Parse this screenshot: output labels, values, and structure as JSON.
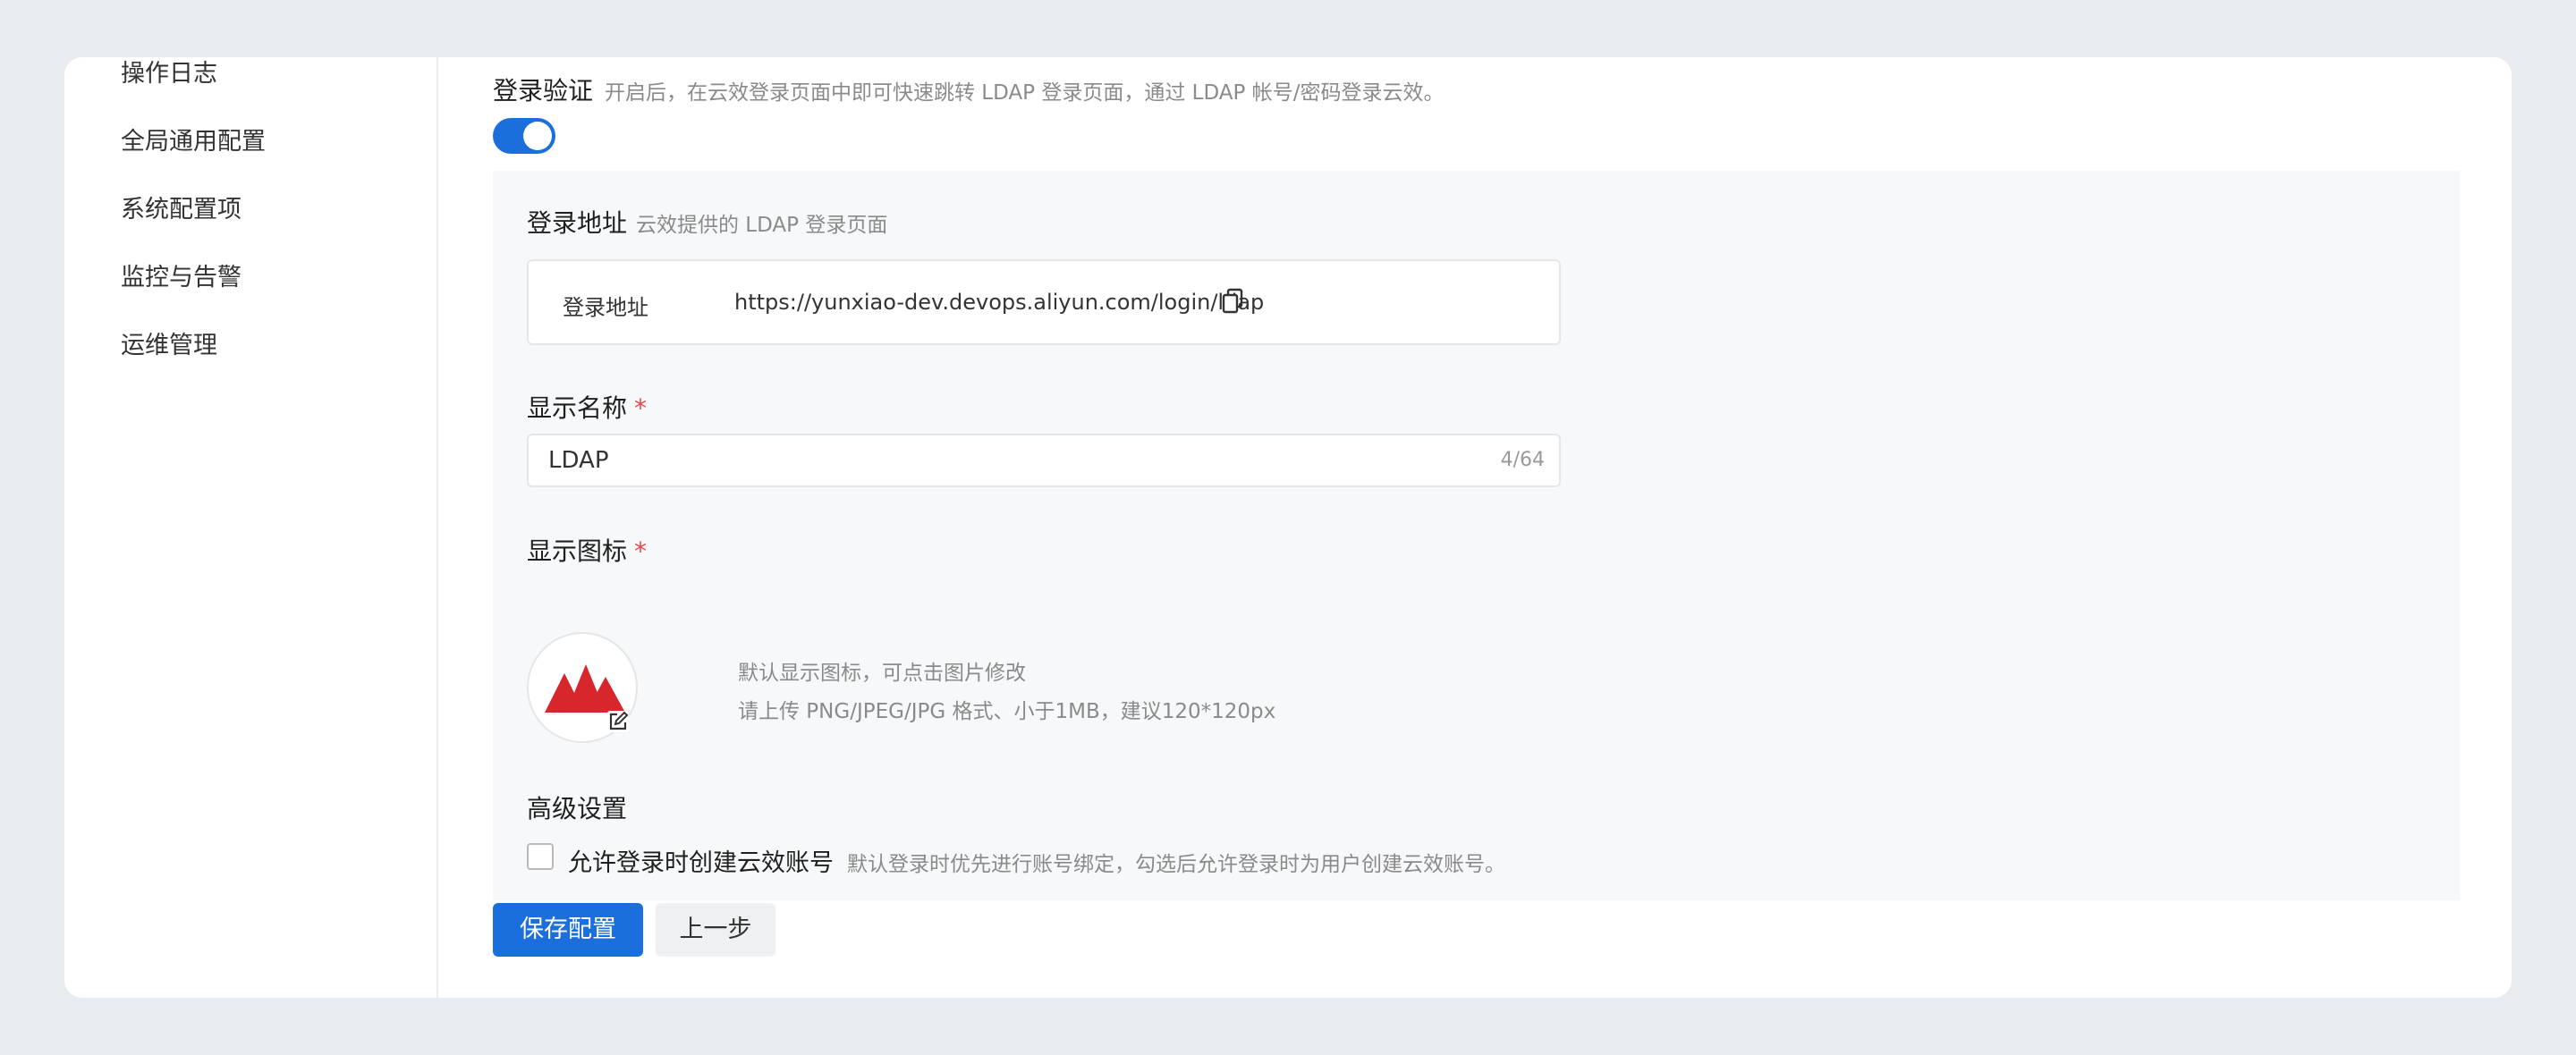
{
  "sidebar": {
    "items": [
      {
        "label": "操作日志"
      },
      {
        "label": "全局通用配置"
      },
      {
        "label": "系统配置项"
      },
      {
        "label": "监控与告警"
      },
      {
        "label": "运维管理"
      }
    ]
  },
  "login_verify": {
    "label": "登录验证",
    "hint": "开启后，在云效登录页面中即可快速跳转 LDAP 登录页面，通过 LDAP 帐号/密码登录云效。",
    "enabled": true
  },
  "login_url": {
    "label": "登录地址",
    "hint": "云效提供的 LDAP 登录页面",
    "key": "登录地址",
    "value": "https://yunxiao-dev.devops.aliyun.com/login/ldap"
  },
  "display_name": {
    "label": "显示名称",
    "required_mark": "*",
    "value": "LDAP",
    "counter": "4/64"
  },
  "display_icon": {
    "label": "显示图标",
    "required_mark": "*",
    "hint_line1": "默认显示图标，可点击图片修改",
    "hint_line2": "请上传 PNG/JPEG/JPG 格式、小于1MB，建议120*120px",
    "logo_color": "#d7262c"
  },
  "advanced": {
    "label": "高级设置",
    "checkbox_label": "允许登录时创建云效账号",
    "checkbox_hint": "默认登录时优先进行账号绑定，勾选后允许登录时为用户创建云效账号。",
    "checked": false
  },
  "actions": {
    "save_label": "保存配置",
    "back_label": "上一步"
  },
  "colors": {
    "primary": "#1b6fdc",
    "background": "#e9ecef",
    "panel": "#f7f8fa",
    "required": "#e5484d"
  }
}
